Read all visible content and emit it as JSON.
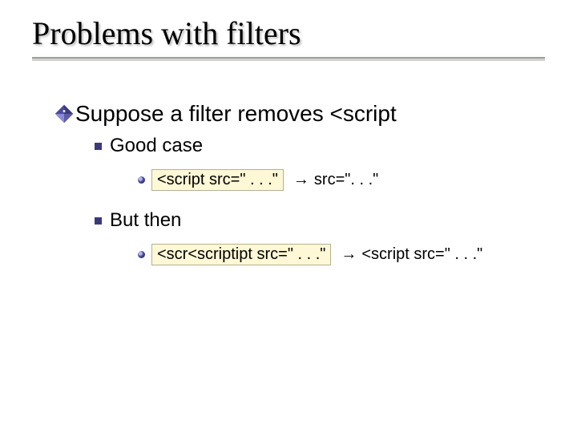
{
  "title": "Problems with filters",
  "lvl1": {
    "text": "Suppose a filter removes <script"
  },
  "good": {
    "label": "Good case",
    "code": "<script src=\" . . .\"",
    "arrow": "→",
    "result": " src=\". . .\""
  },
  "but": {
    "label": "But then",
    "code": "<scr<scriptipt src=\" . . .\"",
    "arrow": "→",
    "result": " <script src=\" . . .\""
  }
}
